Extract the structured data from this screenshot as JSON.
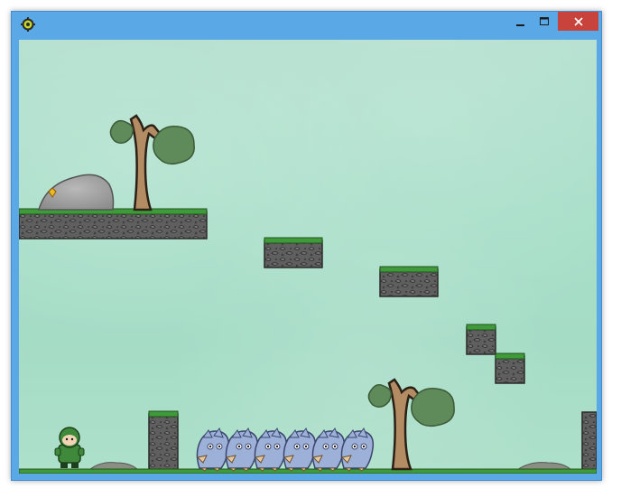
{
  "window": {
    "icon": "gear-icon",
    "controls": {
      "minimize": "minimize-icon",
      "maximize": "maximize-icon",
      "close": "close-icon"
    },
    "colors": {
      "frame": "#5aa9e6",
      "close_button": "#c7433c"
    }
  },
  "game": {
    "sky_color": "#a8dfc9",
    "grass_color": "#3f9a3a",
    "rock_color": "#5f5f5f",
    "tree_color": "#b48c64",
    "foliage_color": "#5f8a5a",
    "player": {
      "sprite": "green-hooded-character"
    },
    "enemies": {
      "sprite": "blue-bird-creature",
      "count": 6
    },
    "collectible": {
      "sprite": "yellow-gem",
      "count": 1
    },
    "platform_count": 9,
    "tree_count": 2
  }
}
